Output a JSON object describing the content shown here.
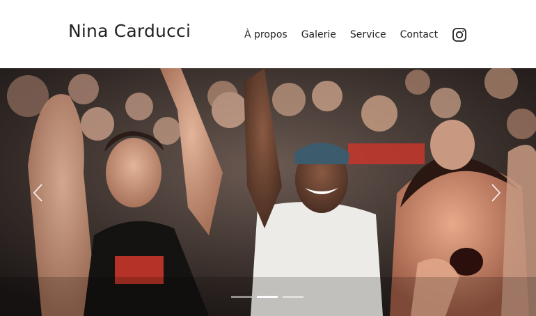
{
  "site": {
    "brand": "Nina Carducci"
  },
  "nav": {
    "items": [
      {
        "label": "À propos"
      },
      {
        "label": "Galerie"
      },
      {
        "label": "Service"
      },
      {
        "label": "Contact"
      }
    ],
    "instagram_icon": "instagram-icon"
  },
  "hero": {
    "image_subject": "concert crowd cheering",
    "prev_icon": "chevron-left-icon",
    "next_icon": "chevron-right-icon",
    "slide_count": 3,
    "active_slide": 2
  },
  "colors": {
    "text": "#222222",
    "background": "#ffffff",
    "indicator": "#ffffff"
  }
}
